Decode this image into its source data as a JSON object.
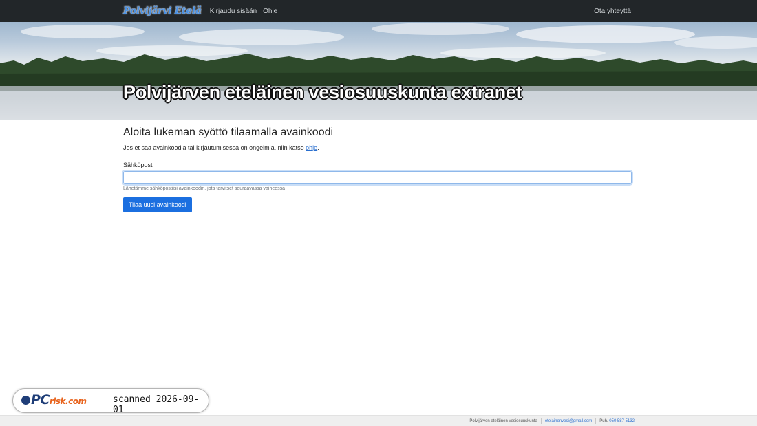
{
  "navbar": {
    "brand": "Polvijärvi Etelä",
    "links": [
      "Kirjaudu sisään",
      "Ohje"
    ],
    "contact": "Ota yhteyttä"
  },
  "hero": {
    "title": "Polvijärven eteläinen vesiosuuskunta extranet"
  },
  "main": {
    "title": "Aloita lukeman syöttö tilaamalla avainkoodi",
    "intro_text": "Jos et saa avainkoodia tai kirjautumisessa on ongelmia, niin katso ",
    "intro_link": "ohje",
    "intro_end": ".",
    "email_label": "Sähköposti",
    "email_value": "",
    "email_help": "Lähetämme sähköpostiisi avainkoodin, jota tarvitset seuraavassa vaiheessa",
    "submit_label": "Tilaa uusi avainkoodi"
  },
  "watermark": {
    "logo_main": "PC",
    "logo_rest": "risk.com",
    "text": "scanned 2026-09-01"
  },
  "footer": {
    "org": "Polvijärven eteläinen vesiosuuskunta",
    "email": "etelainenvesi@gmail.com",
    "phone_label": "Puh.",
    "phone": "050 587 5132"
  },
  "colors": {
    "navbar_bg": "#222629",
    "accent": "#1b6fe0",
    "link": "#2a6fcf"
  }
}
